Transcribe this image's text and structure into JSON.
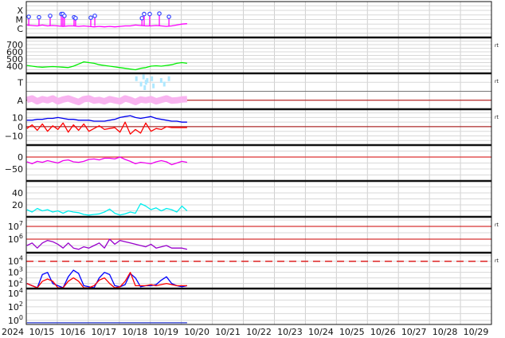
{
  "chart_data": {
    "type": "line",
    "x_start": "2024-10-15T00:00",
    "x_days": 15,
    "sample_hours": 4,
    "year_label": "2024",
    "x_tick_labels": [
      "10/15",
      "10/16",
      "10/17",
      "10/18",
      "10/19",
      "10/20",
      "10/21",
      "10/22",
      "10/23",
      "10/24",
      "10/25",
      "10/26",
      "10/27",
      "10/28",
      "10/29"
    ],
    "realtime_label": "rt",
    "panels": [
      {
        "id": "xray",
        "scale": "log",
        "ylim": [
          -6.96,
          -3.04
        ],
        "ticks": [
          {
            "v": -4,
            "label": "X"
          },
          {
            "v": -5,
            "label": "M"
          },
          {
            "v": -6,
            "label": "C"
          }
        ],
        "series": [
          {
            "name": "xray-flux",
            "color": "#ff00ff",
            "values": [
              -5.6,
              -5.65,
              -5.7,
              -5.6,
              -5.7,
              -5.65,
              -5.7,
              -5.75,
              -5.7,
              -5.7,
              -5.75,
              -5.7,
              -5.75,
              -5.8,
              -5.75,
              -5.8,
              -5.75,
              -5.8,
              -5.75,
              -5.7,
              -5.7,
              -5.6,
              -5.65,
              -5.7,
              -5.7,
              -5.65,
              -5.7,
              -5.75,
              -5.7,
              -5.6,
              -5.5,
              -5.45
            ]
          }
        ],
        "flares_day_offset": [
          0.08,
          0.41,
          0.77,
          1.13,
          1.18,
          1.23,
          1.54,
          1.59,
          2.08,
          2.21,
          3.73,
          3.8,
          3.98,
          4.29,
          4.6
        ],
        "flares_log": [
          -4.7,
          -4.75,
          -4.6,
          -4.4,
          -4.4,
          -4.6,
          -4.75,
          -4.85,
          -4.8,
          -4.6,
          -4.85,
          -4.4,
          -4.4,
          -4.35,
          -4.7
        ]
      },
      {
        "id": "speed",
        "scale": "linear",
        "ylim": [
          300,
          800
        ],
        "ticks": [
          {
            "v": 700,
            "label": "700"
          },
          {
            "v": 600,
            "label": "600"
          },
          {
            "v": 500,
            "label": "500"
          },
          {
            "v": 400,
            "label": "400"
          }
        ],
        "rt": true,
        "series": [
          {
            "name": "solar-wind-speed",
            "color": "#00ee00",
            "values": [
              410,
              400,
              390,
              385,
              390,
              395,
              390,
              385,
              380,
              400,
              430,
              460,
              450,
              440,
              420,
              410,
              400,
              390,
              380,
              370,
              360,
              350,
              370,
              380,
              400,
              405,
              400,
              410,
              420,
              440,
              450,
              440
            ]
          }
        ]
      },
      {
        "id": "kp",
        "scale": "linear",
        "ylim": [
          0,
          1
        ],
        "ticks": [
          {
            "v": 0.75,
            "label": "T"
          },
          {
            "v": 0.25,
            "label": "A"
          }
        ],
        "rt": true,
        "series": [
          {
            "name": "a-index-band",
            "color": "#f8b4f0",
            "values": [
              0.26,
              0.3,
              0.22,
              0.28,
              0.25,
              0.3,
              0.22,
              0.27,
              0.3,
              0.25,
              0.2,
              0.28,
              0.3,
              0.24,
              0.26,
              0.22,
              0.28,
              0.25,
              0.22,
              0.3,
              0.26,
              0.2,
              0.27,
              0.25,
              0.28,
              0.22,
              0.26,
              0.3,
              0.24,
              0.25,
              0.27,
              0.28
            ]
          }
        ],
        "t_points_day_offset": [
          3.55,
          3.7,
          3.78,
          3.82,
          3.86,
          3.9,
          4.05,
          4.1,
          4.35,
          4.45,
          4.6
        ],
        "t_points": [
          0.85,
          0.7,
          0.9,
          0.6,
          0.75,
          0.8,
          0.85,
          0.65,
          0.8,
          0.7,
          0.85
        ]
      },
      {
        "id": "mag",
        "scale": "linear",
        "ylim": [
          -20,
          19
        ],
        "ticks": [
          {
            "v": 10,
            "label": "10"
          },
          {
            "v": 0,
            "label": "0"
          },
          {
            "v": -10,
            "label": "−10"
          }
        ],
        "rt": true,
        "series": [
          {
            "name": "bt",
            "color": "#0000ee",
            "values": [
              7,
              7,
              8,
              8,
              9,
              9,
              10,
              9,
              8,
              8,
              7,
              7,
              7,
              6,
              6,
              6,
              7,
              8,
              10,
              11,
              12,
              10,
              9,
              10,
              11,
              9,
              8,
              7,
              6,
              6,
              5,
              5
            ]
          },
          {
            "name": "bz",
            "color": "#ff0000",
            "values": [
              -2,
              2,
              -4,
              3,
              -5,
              1,
              -3,
              4,
              -6,
              2,
              -4,
              3,
              -5,
              -2,
              1,
              -3,
              -2,
              -1,
              -6,
              5,
              -8,
              -3,
              -7,
              4,
              -5,
              -2,
              -3,
              0,
              -1,
              -1,
              -1,
              -1
            ]
          }
        ]
      },
      {
        "id": "dst",
        "scale": "linear",
        "ylim": [
          -100,
          50
        ],
        "ticks": [
          {
            "v": 0,
            "label": "0"
          },
          {
            "v": -50,
            "label": "−50"
          }
        ],
        "series": [
          {
            "name": "dst",
            "color": "#ee00ee",
            "values": [
              -20,
              -28,
              -18,
              -22,
              -15,
              -20,
              -25,
              -15,
              -12,
              -20,
              -22,
              -18,
              -10,
              -8,
              -12,
              -5,
              -5,
              -8,
              0,
              -10,
              -18,
              -28,
              -22,
              -25,
              -28,
              -20,
              -15,
              -20,
              -32,
              -25,
              -18,
              -22
            ]
          }
        ]
      },
      {
        "id": "density",
        "scale": "linear",
        "ylim": [
          0,
          60
        ],
        "ticks": [
          {
            "v": 40,
            "label": "40"
          },
          {
            "v": 20,
            "label": "20"
          }
        ],
        "series": [
          {
            "name": "density",
            "color": "#00eeee",
            "values": [
              12,
              8,
              14,
              10,
              12,
              8,
              10,
              6,
              10,
              8,
              7,
              4,
              3,
              4,
              5,
              8,
              13,
              6,
              3,
              5,
              8,
              6,
              22,
              18,
              12,
              15,
              10,
              14,
              12,
              8,
              18,
              10
            ]
          }
        ]
      },
      {
        "id": "electron",
        "scale": "log",
        "ylim": [
          4.94,
          7.75
        ],
        "ticks": [
          {
            "v": 7,
            "label": "10^7"
          },
          {
            "v": 6,
            "label": "10^6"
          }
        ],
        "rt": true,
        "series": [
          {
            "name": "electron-flux",
            "color": "#9900cc",
            "values": [
              5.5,
              5.7,
              5.3,
              5.7,
              5.9,
              5.8,
              5.6,
              5.3,
              5.7,
              5.3,
              5.2,
              5.4,
              5.3,
              5.5,
              5.7,
              5.3,
              6.0,
              5.6,
              5.9,
              5.8,
              5.7,
              5.6,
              5.5,
              5.4,
              5.6,
              5.3,
              5.4,
              5.5,
              5.3,
              5.3,
              5.3,
              5.2
            ]
          }
        ]
      },
      {
        "id": "proton",
        "scale": "log",
        "ylim": [
          1.54,
          4.77
        ],
        "ticks": [
          {
            "v": 4,
            "label": "10^4"
          },
          {
            "v": 3,
            "label": "10^3"
          },
          {
            "v": 2,
            "label": "10^2"
          }
        ],
        "rt": true,
        "series": [
          {
            "name": "proton-blue",
            "color": "#0000ff",
            "values": [
              2,
              1.8,
              1.6,
              2.8,
              3.0,
              2.0,
              1.8,
              1.6,
              2.6,
              3.2,
              2.9,
              1.8,
              1.7,
              1.6,
              2.5,
              3.0,
              2.8,
              1.8,
              1.7,
              1.9,
              2.9,
              2.5,
              1.7,
              1.8,
              1.8,
              1.9,
              2.3,
              2.6,
              2.0,
              1.8,
              1.7,
              1.8
            ]
          },
          {
            "name": "proton-red",
            "color": "#ff0000",
            "values": [
              2,
              1.8,
              1.6,
              2.2,
              2.4,
              2.2,
              1.6,
              1.6,
              2.2,
              2.5,
              2.2,
              1.6,
              1.6,
              1.8,
              2.3,
              2.5,
              2.0,
              1.6,
              1.7,
              2.2,
              3.0,
              1.8,
              1.8,
              1.8,
              1.9,
              1.8,
              1.9,
              2.0,
              1.9,
              1.8,
              1.8,
              1.8
            ]
          }
        ]
      },
      {
        "id": "neutron",
        "scale": "log",
        "ylim": [
          -0.6,
          4.7
        ],
        "ticks": [
          {
            "v": 4,
            "label": "10^4"
          },
          {
            "v": 2,
            "label": "10^2"
          },
          {
            "v": 0,
            "label": "10^0"
          }
        ],
        "series": [
          {
            "name": "flux-low",
            "color": "#2233cc",
            "values": [
              -0.35,
              -0.35,
              -0.35,
              -0.35,
              -0.35,
              -0.35,
              -0.35,
              -0.35,
              -0.35,
              -0.35,
              -0.35,
              -0.35,
              -0.35,
              -0.35,
              -0.35,
              -0.35,
              -0.35,
              -0.35,
              -0.35,
              -0.35,
              -0.35,
              -0.35,
              -0.35,
              -0.35,
              -0.35,
              -0.35,
              -0.35,
              -0.35,
              -0.35,
              -0.35,
              -0.35,
              -0.35
            ]
          }
        ]
      }
    ]
  }
}
